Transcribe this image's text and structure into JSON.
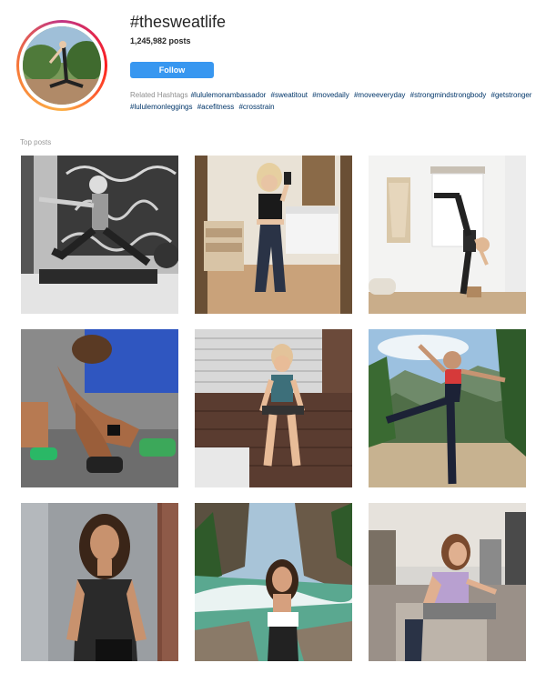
{
  "hashtag": {
    "title": "#thesweatlife",
    "post_count": "1,245,982 posts",
    "follow_label": "Follow"
  },
  "related": {
    "label": "Related Hashtags",
    "tags": [
      "#lululemonambassador",
      "#sweatitout",
      "#movedaily",
      "#moveeveryday",
      "#strongmindstrongbody",
      "#getstronger",
      "#lululemonleggings",
      "#acefitness",
      "#crosstrain"
    ]
  },
  "top_posts_label": "Top posts",
  "colors": {
    "follow_button": "#3897f0",
    "hashtag_link": "#003569",
    "muted_text": "#8e8e8e"
  },
  "posts": [
    {
      "name": "post-reformer-pilates"
    },
    {
      "name": "post-mirror-selfie"
    },
    {
      "name": "post-standing-yoga-pose"
    },
    {
      "name": "post-tying-shoes"
    },
    {
      "name": "post-deck-workout"
    },
    {
      "name": "post-mountain-pose"
    },
    {
      "name": "post-smiling-portrait"
    },
    {
      "name": "post-river-portrait"
    },
    {
      "name": "post-city-balcony"
    }
  ]
}
